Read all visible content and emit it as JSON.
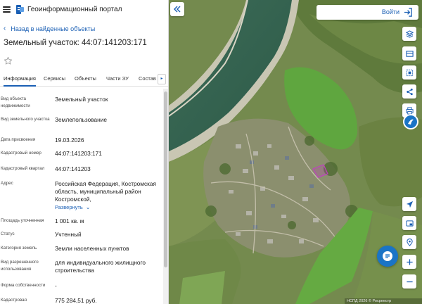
{
  "header": {
    "portal_title": "Геоинформационный портал"
  },
  "nav": {
    "back_label": "Назад в найденные объекты"
  },
  "object": {
    "title": "Земельный участок: 44:07:141203:171"
  },
  "tabs": [
    {
      "label": "Информация",
      "active": true
    },
    {
      "label": "Сервисы",
      "active": false
    },
    {
      "label": "Объекты",
      "active": false
    },
    {
      "label": "Части ЗУ",
      "active": false
    },
    {
      "label": "Состав",
      "active": false
    }
  ],
  "properties": [
    {
      "label": "Вид объекта недвижимости",
      "value": "Земельный участок"
    },
    {
      "label": "Вид земельного участка",
      "value": "Землепользование"
    },
    {
      "label": "Дата присвоения",
      "value": "19.03.2026"
    },
    {
      "label": "Кадастровый номер",
      "value": "44:07:141203:171"
    },
    {
      "label": "Кадастровый квартал",
      "value": "44:07:141203"
    },
    {
      "label": "Адрес",
      "value": "Российская Федерация, Костромская область, муниципальный район Костромской,",
      "expand_label": "Развернуть"
    },
    {
      "label": "Площадь уточненная",
      "value": "1 001 кв. м"
    },
    {
      "label": "Статус",
      "value": "Учтенный"
    },
    {
      "label": "Категория земель",
      "value": "Земли населенных пунктов"
    },
    {
      "label": "Вид разрешенного использования",
      "value": "для индивидуального жилищного строительства"
    },
    {
      "label": "Форма собственности",
      "value": "-"
    },
    {
      "label": "Кадастровая",
      "value": "775 284,51 руб."
    }
  ],
  "map": {
    "login_label": "Войти",
    "attribution": "НСПД 2026 © Росреестр"
  },
  "colors": {
    "accent": "#1a5fb4",
    "badge_blue": "#1a74c6",
    "parcel_outline": "#c040c0"
  },
  "icons": {
    "menu": "hamburger-icon",
    "back": "chevron-left-icon",
    "favorite": "star-outline-icon",
    "login": "sign-in-icon",
    "layers": "layers-icon",
    "basemap": "basemap-icon",
    "select": "select-area-icon",
    "share": "share-icon",
    "print": "print-icon",
    "navigate": "navigation-arrow-icon",
    "window": "window-icon",
    "location": "location-pin-icon",
    "zoom_in": "plus-icon",
    "zoom_out": "minus-icon",
    "chat": "chat-icon"
  }
}
